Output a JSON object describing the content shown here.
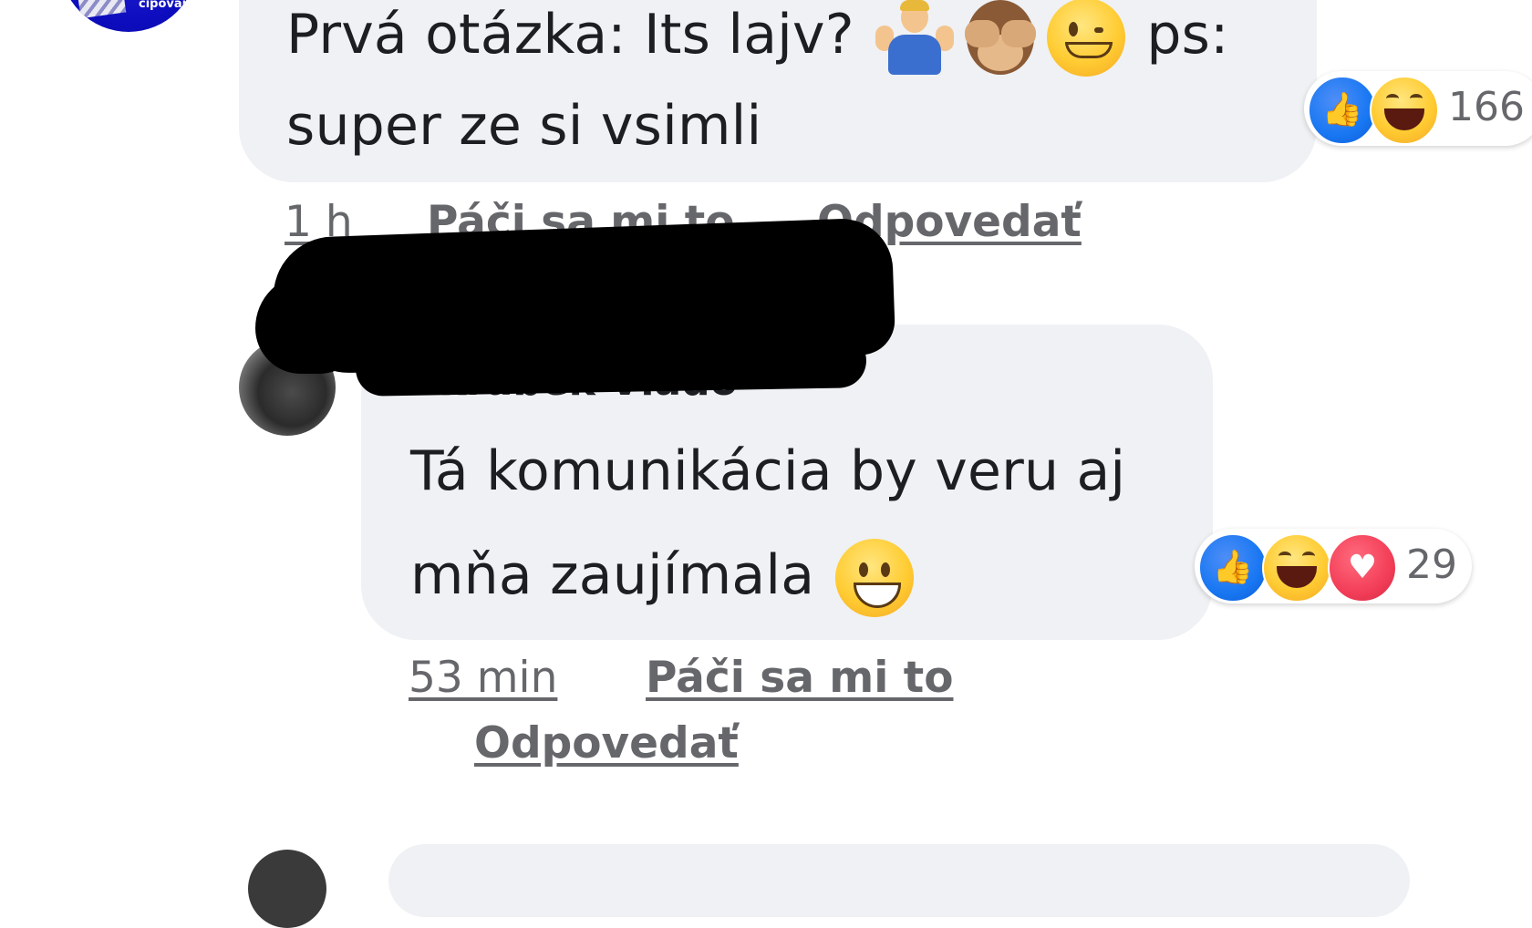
{
  "page": {
    "avatar_text": "cipovar"
  },
  "comment1": {
    "text_line1": "Prvá otázka: Its lajv?",
    "text_ps": "ps:",
    "text_line2": "super ze si vsimli",
    "emojis": [
      "person-shrugging-icon",
      "see-no-evil-monkey-icon",
      "winking-face-icon"
    ],
    "reactions": {
      "icons": [
        "like-icon",
        "haha-icon"
      ],
      "count": "166"
    },
    "meta": {
      "time": "1 h",
      "like": "Páči sa mi to",
      "reply": "Odpovedať"
    }
  },
  "comment2": {
    "author": "Skrabek Vlado",
    "text_line1": "Tá komunikácia by veru aj",
    "text_line2": "mňa zaujímala",
    "emojis": [
      "grinning-face-icon"
    ],
    "reactions": {
      "icons": [
        "like-icon",
        "haha-icon",
        "love-icon"
      ],
      "count": "29"
    },
    "meta": {
      "time": "53 min",
      "like": "Páči sa mi to",
      "reply": "Odpovedať"
    }
  },
  "colors": {
    "bubble": "#eff1f4",
    "meta_text": "#65676b",
    "like_blue": "#1877f2",
    "love_red": "#f33e58",
    "haha_yellow": "#ffcc33"
  }
}
